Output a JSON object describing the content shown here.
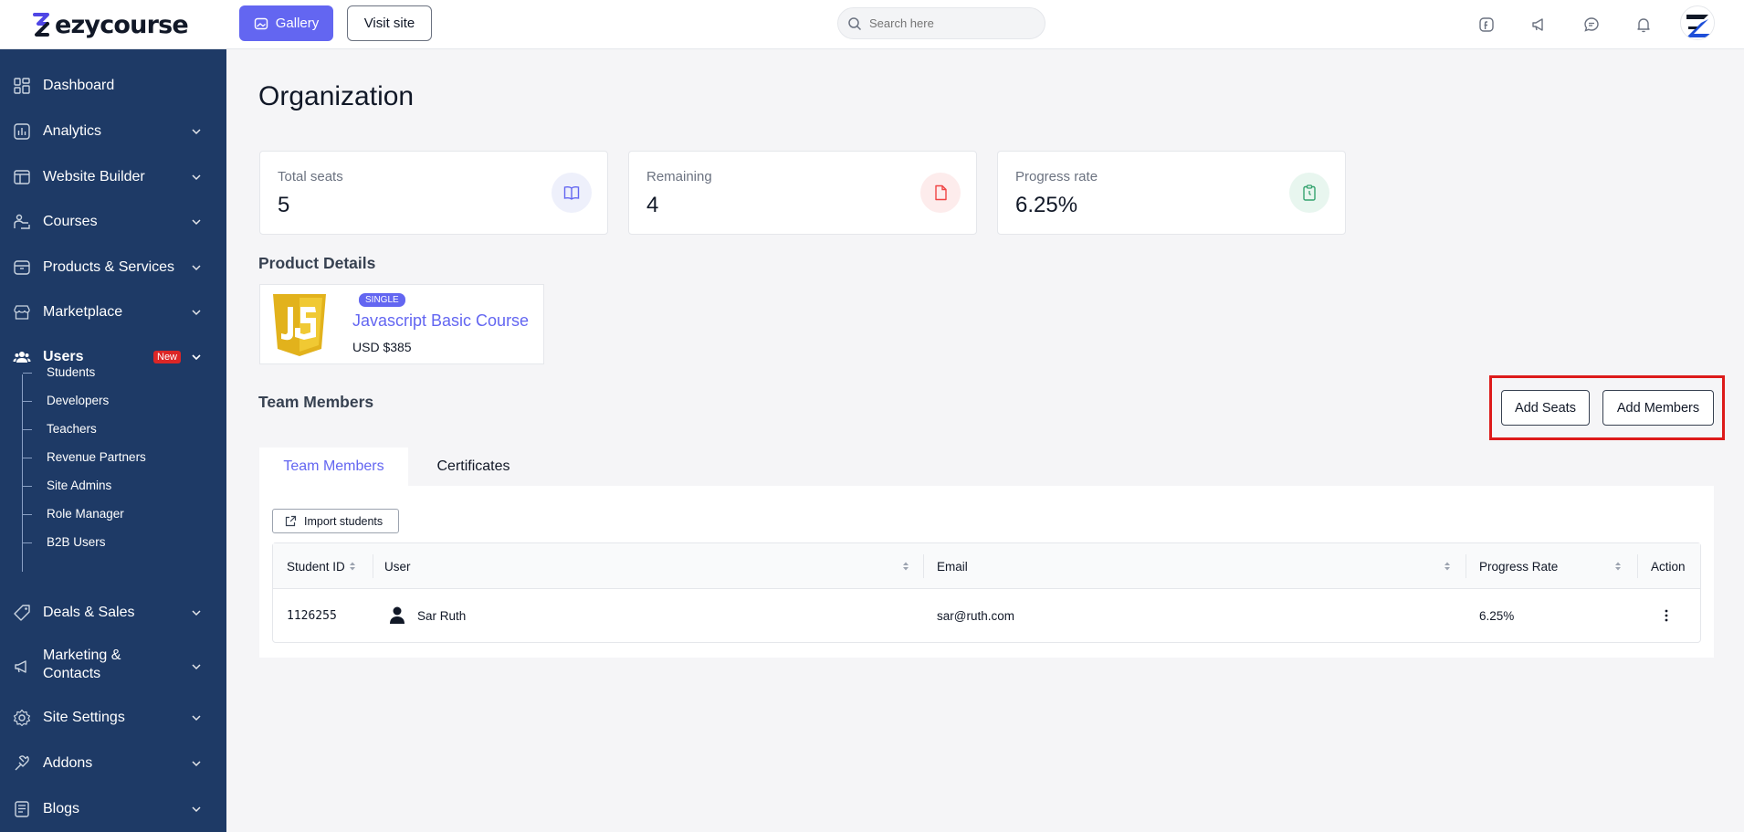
{
  "header": {
    "logo_text": "ezycourse",
    "gallery_label": "Gallery",
    "visit_site_label": "Visit site",
    "search_placeholder": "Search here",
    "icons": [
      "facebook-icon",
      "megaphone-icon",
      "chat-icon",
      "bell-icon"
    ]
  },
  "sidebar": {
    "items": [
      {
        "label": "Dashboard",
        "icon": "dashboard-icon"
      },
      {
        "label": "Analytics",
        "icon": "analytics-icon"
      },
      {
        "label": "Website Builder",
        "icon": "website-builder-icon"
      },
      {
        "label": "Courses",
        "icon": "courses-icon"
      },
      {
        "label": "Products & Services",
        "icon": "products-icon"
      },
      {
        "label": "Marketplace",
        "icon": "marketplace-icon"
      },
      {
        "label": "Users",
        "icon": "users-icon",
        "badge": "New"
      },
      {
        "label": "Deals & Sales",
        "icon": "deals-icon"
      },
      {
        "label": "Marketing &",
        "label2": "Contacts",
        "icon": "marketing-icon"
      },
      {
        "label": "Site Settings",
        "icon": "settings-icon"
      },
      {
        "label": "Addons",
        "icon": "addons-icon"
      },
      {
        "label": "Blogs",
        "icon": "blogs-icon"
      }
    ],
    "users_sub": [
      "Students",
      "Developers",
      "Teachers",
      "Revenue Partners",
      "Site Admins",
      "Role Manager",
      "B2B Users"
    ]
  },
  "main": {
    "title": "Organization",
    "cards": [
      {
        "label": "Total seats",
        "value": "5",
        "icon": "book-icon",
        "color": "#eef0fb"
      },
      {
        "label": "Remaining",
        "value": "4",
        "icon": "document-icon",
        "color": "#fdecec"
      },
      {
        "label": "Progress rate",
        "value": "6.25%",
        "icon": "clipboard-icon",
        "color": "#e8f6ef"
      }
    ],
    "product_section_title": "Product Details",
    "product": {
      "badge": "SINGLE",
      "name": "Javascript Basic Course",
      "price": "USD $385",
      "logo_text": "JS"
    },
    "team_title": "Team Members",
    "add_seats_label": "Add Seats",
    "add_members_label": "Add Members",
    "tabs": [
      {
        "label": "Team Members",
        "active": true
      },
      {
        "label": "Certificates",
        "active": false
      }
    ],
    "import_label": "Import students",
    "table": {
      "columns": [
        "Student ID",
        "User",
        "Email",
        "Progress Rate",
        "Action"
      ],
      "rows": [
        {
          "id": "1126255",
          "user": "Sar Ruth",
          "email": "sar@ruth.com",
          "progress": "6.25%"
        }
      ]
    }
  },
  "colors": {
    "accent": "#6366f1",
    "sidebar": "#1e3a66",
    "highlight": "#dd1a1a"
  }
}
